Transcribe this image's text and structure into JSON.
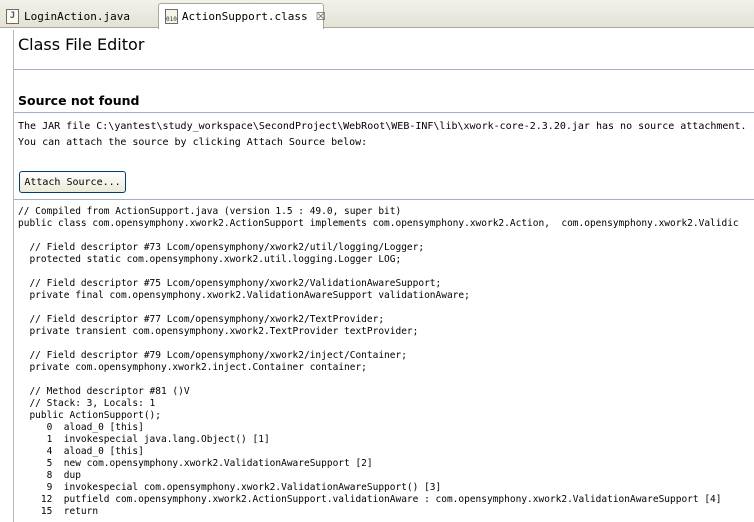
{
  "tabs": [
    {
      "label": "LoginAction.java",
      "icon": "java-file-icon",
      "active": false
    },
    {
      "label": "ActionSupport.class",
      "icon": "class-file-icon",
      "active": true
    }
  ],
  "editor": {
    "title": "Class File Editor",
    "section_title": "Source not found",
    "message_1": "The JAR file C:\\yantest\\study_workspace\\SecondProject\\WebRoot\\WEB-INF\\lib\\xwork-core-2.3.20.jar has no source attachment.",
    "message_2": "You can attach the source by clicking Attach Source below:",
    "attach_button": "Attach Source..."
  },
  "code_lines": [
    "// Compiled from ActionSupport.java (version 1.5 : 49.0, super bit)",
    "public class com.opensymphony.xwork2.ActionSupport implements com.opensymphony.xwork2.Action,  com.opensymphony.xwork2.Validic",
    "",
    "  // Field descriptor #73 Lcom/opensymphony/xwork2/util/logging/Logger;",
    "  protected static com.opensymphony.xwork2.util.logging.Logger LOG;",
    "",
    "  // Field descriptor #75 Lcom/opensymphony/xwork2/ValidationAwareSupport;",
    "  private final com.opensymphony.xwork2.ValidationAwareSupport validationAware;",
    "",
    "  // Field descriptor #77 Lcom/opensymphony/xwork2/TextProvider;",
    "  private transient com.opensymphony.xwork2.TextProvider textProvider;",
    "",
    "  // Field descriptor #79 Lcom/opensymphony/xwork2/inject/Container;",
    "  private com.opensymphony.xwork2.inject.Container container;",
    "",
    "  // Method descriptor #81 ()V",
    "  // Stack: 3, Locals: 1",
    "  public ActionSupport();",
    "     0  aload_0 [this]",
    "     1  invokespecial java.lang.Object() [1]",
    "     4  aload_0 [this]",
    "     5  new com.opensymphony.xwork2.ValidationAwareSupport [2]",
    "     8  dup",
    "     9  invokespecial com.opensymphony.xwork2.ValidationAwareSupport() [3]",
    "    12  putfield com.opensymphony.xwork2.ActionSupport.validationAware : com.opensymphony.xwork2.ValidationAwareSupport [4]",
    "    15  return"
  ]
}
